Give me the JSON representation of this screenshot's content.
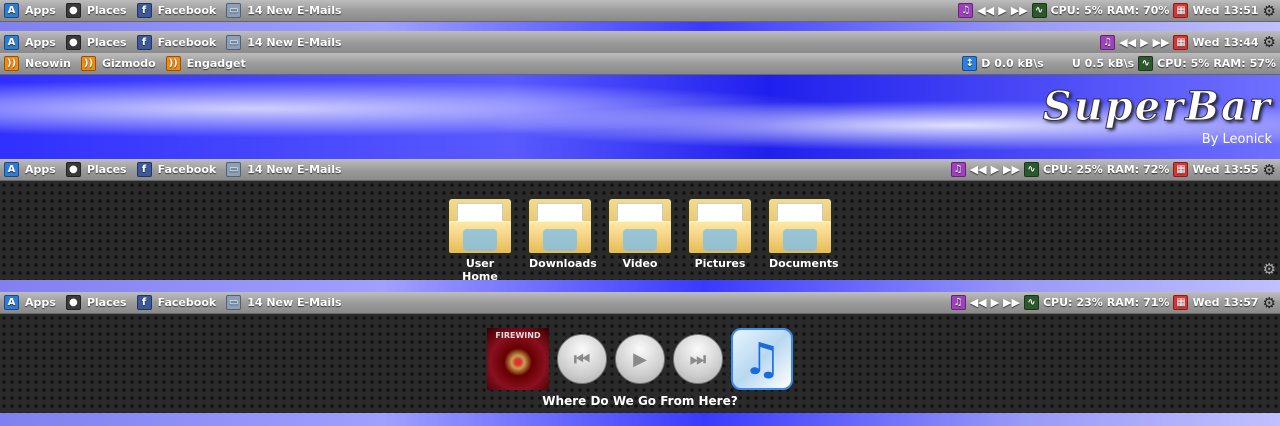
{
  "launchers": [
    {
      "label": "Apps",
      "icon": "app-store-icon",
      "glyph": "A",
      "color": "#2e7bd8"
    },
    {
      "label": "Places",
      "icon": "drive-icon",
      "glyph": "●",
      "color": "#3a3a3a"
    },
    {
      "label": "Facebook",
      "icon": "facebook-icon",
      "glyph": "f",
      "color": "#3b5998"
    },
    {
      "label": "14 New E-Mails",
      "icon": "mail-icon",
      "glyph": "▭",
      "color": "#8aa0b8"
    }
  ],
  "feeds": [
    {
      "label": "Neowin",
      "icon": "rss-icon"
    },
    {
      "label": "Gizmodo",
      "icon": "rss-icon"
    },
    {
      "label": "Engadget",
      "icon": "rss-icon"
    }
  ],
  "bars": [
    {
      "cpu_label": "CPU:",
      "cpu": "5%",
      "ram_label": "RAM:",
      "ram": "70%",
      "day": "Wed",
      "time": "13:51"
    },
    {
      "day": "Wed",
      "time": "13:44",
      "down": "D 0.0 kB\\s",
      "up": "U 0.5 kB\\s",
      "cpu_label": "CPU:",
      "cpu": "5%",
      "ram_label": "RAM:",
      "ram": "57%"
    },
    {
      "cpu_label": "CPU:",
      "cpu": "25%",
      "ram_label": "RAM:",
      "ram": "72%",
      "day": "Wed",
      "time": "13:55"
    },
    {
      "cpu_label": "CPU:",
      "cpu": "23%",
      "ram_label": "RAM:",
      "ram": "71%",
      "day": "Wed",
      "time": "13:57"
    }
  ],
  "banner": {
    "title": "SuperBar",
    "subtitle": "By Leonick"
  },
  "folders": [
    "User Home",
    "Downloads",
    "Video",
    "Pictures",
    "Documents"
  ],
  "media": {
    "album_text": "FIREWIND",
    "song": "Where Do We Go From Here?"
  }
}
